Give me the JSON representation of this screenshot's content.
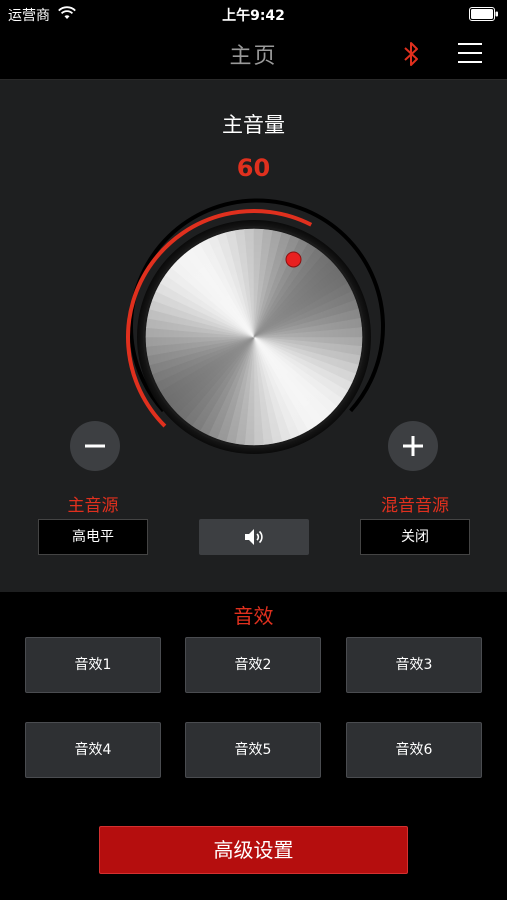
{
  "status_bar": {
    "carrier": "运营商",
    "time": "上午9:42"
  },
  "nav": {
    "title": "主页",
    "bluetooth_icon": "bluetooth-icon",
    "menu_icon": "hamburger-menu-icon"
  },
  "volume": {
    "label": "主音量",
    "value": "60",
    "level": 0.6
  },
  "controls": {
    "minus_icon": "minus-icon",
    "plus_icon": "plus-icon",
    "speaker_icon": "speaker-icon"
  },
  "sources": {
    "main_label": "主音源",
    "main_value": "高电平",
    "mix_label": "混音音源",
    "mix_value": "关闭"
  },
  "effects": {
    "title": "音效",
    "items": [
      "音效1",
      "音效2",
      "音效3",
      "音效4",
      "音效5",
      "音效6"
    ]
  },
  "advanced_label": "高级设置",
  "colors": {
    "accent": "#e0301e",
    "panel": "#1e1f20",
    "button": "#2e3033",
    "advanced_button": "#b50e0e"
  }
}
